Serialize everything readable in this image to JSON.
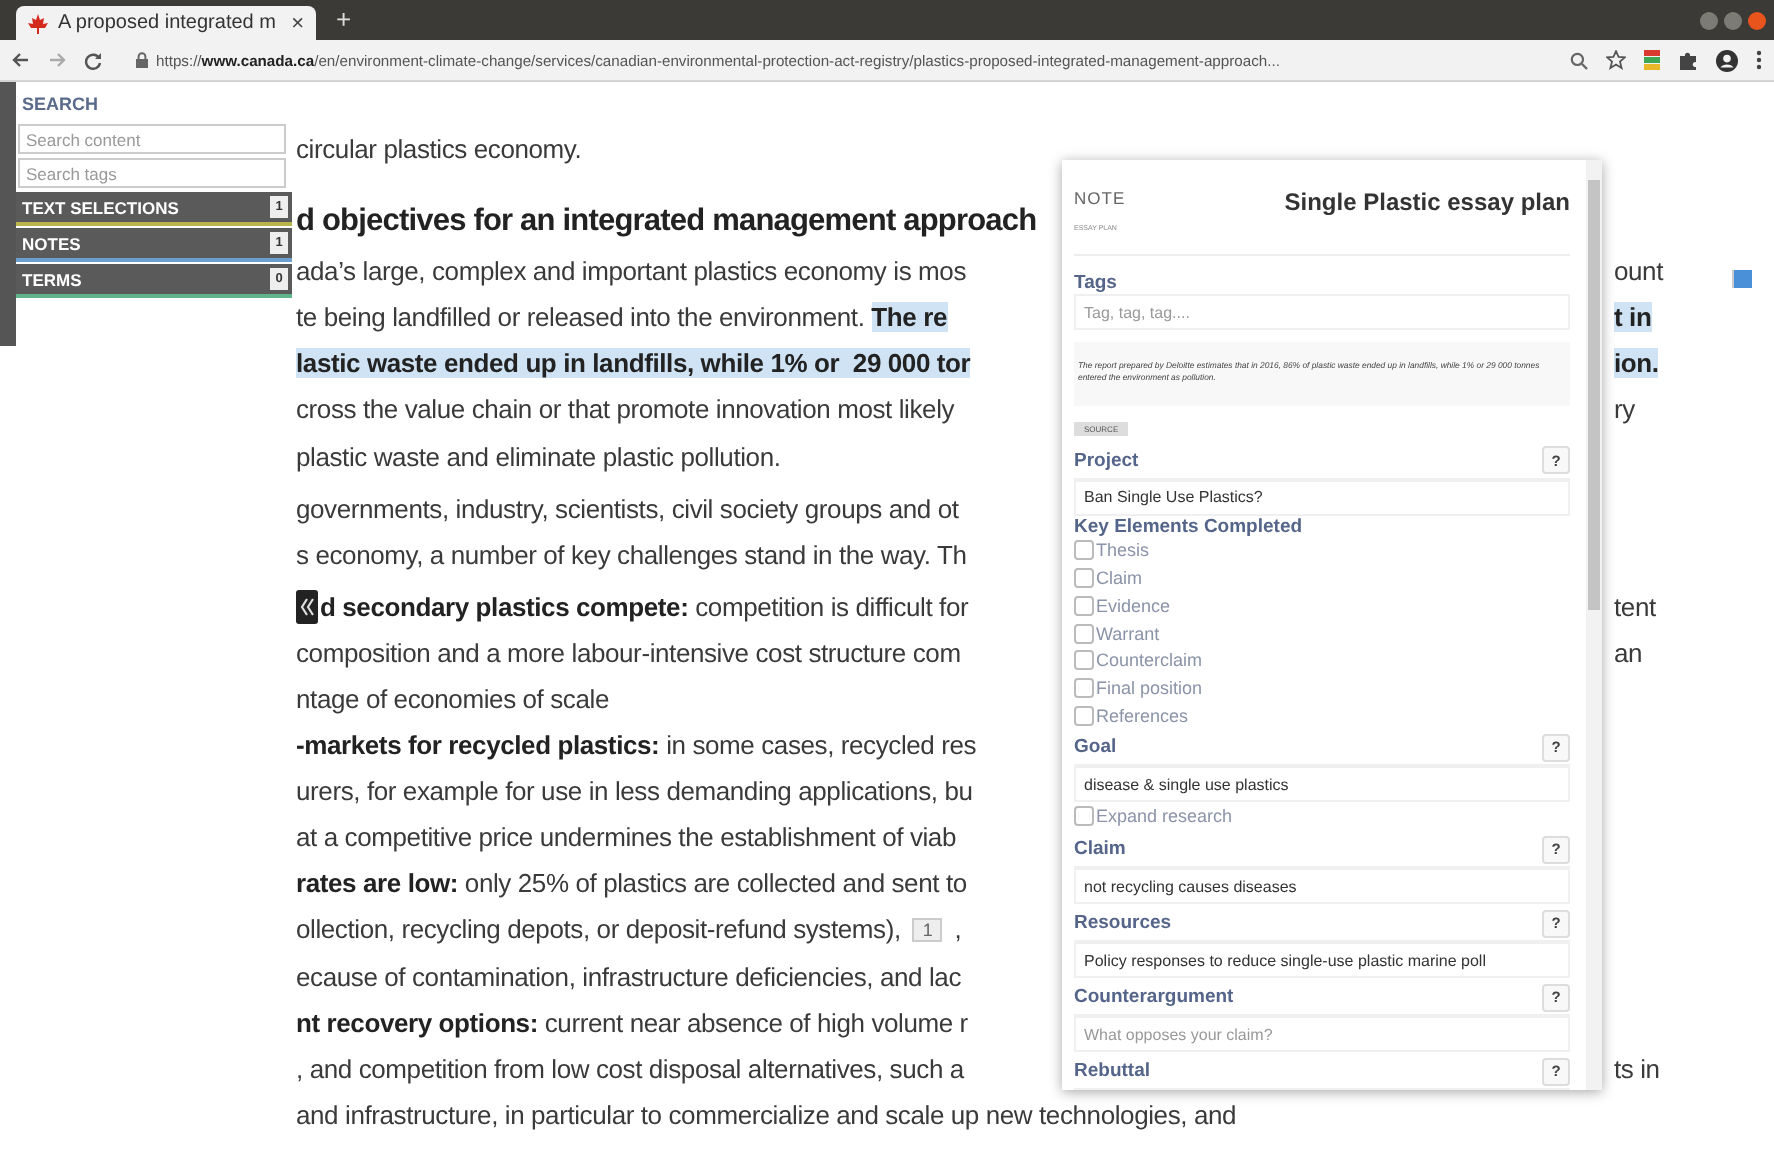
{
  "browser": {
    "tab": {
      "title": "A proposed integrated m",
      "close": "×"
    },
    "new_tab": "+",
    "url": "https://**www.canada.ca**/en/environment-climate-change/services/canadian-environmental-protection-act-registry/plastics-proposed-integrated-management-approach..."
  },
  "sidebar": {
    "title": "SEARCH",
    "fields": [
      {
        "placeholder": "Search content"
      },
      {
        "placeholder": "Search tags"
      }
    ],
    "sections": [
      {
        "label": "TEXT SELECTIONS",
        "count": "1",
        "color": "#b8b44c"
      },
      {
        "label": "NOTES",
        "count": "1",
        "color": "#6d9fd0"
      },
      {
        "label": "TERMS",
        "count": "0",
        "color": "#5fb48a"
      }
    ]
  },
  "document": {
    "lines": [
      {
        "kind": "text",
        "parts": [
          {
            "text": "circular plastics economy.",
            "bold": false,
            "highlighted": false
          }
        ]
      },
      {
        "kind": "heading",
        "parts": [
          {
            "text": "d objectives for an integrated management approach",
            "bold": true,
            "highlighted": false
          }
        ]
      },
      {
        "kind": "text",
        "parts": [
          {
            "text": "ada’s large, complex and important plastics economy is mos",
            "bold": false,
            "highlighted": false
          }
        ],
        "right": {
          "text": "ount",
          "bold": false,
          "highlighted": false
        }
      },
      {
        "kind": "text",
        "parts": [
          {
            "text": "te being landfilled or released into the environment. ",
            "bold": false,
            "highlighted": false
          },
          {
            "text": "The re",
            "bold": true,
            "highlighted": true
          }
        ],
        "right": {
          "text": "t in",
          "bold": true,
          "highlighted": true
        }
      },
      {
        "kind": "text",
        "parts": [
          {
            "text": "lastic waste ended up in landfills, while 1% or  29 000 tor",
            "bold": true,
            "highlighted": true
          }
        ],
        "right": {
          "text": "ion.",
          "bold": true,
          "highlighted": true
        }
      },
      {
        "kind": "text",
        "parts": [
          {
            "text": "cross the value chain or that promote innovation most likely",
            "bold": false,
            "highlighted": false
          }
        ],
        "right": {
          "text": "ry",
          "bold": false,
          "highlighted": false
        }
      },
      {
        "kind": "text",
        "parts": [
          {
            "text": "plastic waste and eliminate plastic pollution.",
            "bold": false,
            "highlighted": false
          }
        ]
      },
      {
        "kind": "paragraph",
        "parts": [
          {
            "text": "governments, industry, scientists, civil society groups and ot",
            "bold": false,
            "highlighted": false
          }
        ]
      },
      {
        "kind": "text",
        "parts": [
          {
            "text": "s economy, a number of key challenges stand in the way. Th",
            "bold": false,
            "highlighted": false
          }
        ]
      },
      {
        "kind": "marker",
        "parts": [
          {
            "text": "d secondary plastics compete:",
            "bold": true,
            "highlighted": false
          },
          {
            "text": " competition is difficult for",
            "bold": false,
            "highlighted": false
          }
        ],
        "right": {
          "text": "tent",
          "bold": false,
          "highlighted": false
        }
      },
      {
        "kind": "text",
        "parts": [
          {
            "text": "composition and a more labour-intensive cost structure com",
            "bold": false,
            "highlighted": false
          }
        ],
        "right": {
          "text": "an",
          "bold": false,
          "highlighted": false
        }
      },
      {
        "kind": "text",
        "parts": [
          {
            "text": "ntage of economies of scale",
            "bold": false,
            "highlighted": false
          }
        ]
      },
      {
        "kind": "text",
        "parts": [
          {
            "text": "-markets for recycled plastics:",
            "bold": true,
            "highlighted": false
          },
          {
            "text": " in some cases, recycled res",
            "bold": false,
            "highlighted": false
          }
        ]
      },
      {
        "kind": "text",
        "parts": [
          {
            "text": "urers, for example for use in less demanding applications, bu",
            "bold": false,
            "highlighted": false
          }
        ]
      },
      {
        "kind": "text",
        "parts": [
          {
            "text": "at a competitive price undermines the establishment of viab",
            "bold": false,
            "highlighted": false
          }
        ]
      },
      {
        "kind": "text",
        "parts": [
          {
            "text": "rates are low:",
            "bold": true,
            "highlighted": false
          },
          {
            "text": " only 25% of plastics are collected and sent to",
            "bold": false,
            "highlighted": false
          }
        ]
      },
      {
        "kind": "footnoted",
        "parts": [
          {
            "text": "ollection, recycling depots, or deposit-refund systems),",
            "bold": false,
            "highlighted": false
          },
          {
            "text": "1",
            "kind": "footnote"
          },
          {
            "text": ",",
            "bold": false,
            "highlighted": false
          }
        ]
      },
      {
        "kind": "text",
        "parts": [
          {
            "text": "ecause of contamination, infrastructure deficiencies, and lac",
            "bold": false,
            "highlighted": false
          }
        ]
      },
      {
        "kind": "text",
        "parts": [
          {
            "text": "nt recovery options:",
            "bold": true,
            "highlighted": false
          },
          {
            "text": " current near absence of high volume r",
            "bold": false,
            "highlighted": false
          }
        ]
      },
      {
        "kind": "text",
        "parts": [
          {
            "text": ", and competition from low cost disposal alternatives, such a",
            "bold": false,
            "highlighted": false
          }
        ],
        "right": {
          "text": "ts in",
          "bold": false,
          "highlighted": false
        }
      },
      {
        "kind": "text",
        "parts": [
          {
            "text": "and infrastructure, in particular to commercialize and scale up new technologies, and",
            "bold": false,
            "highlighted": false
          }
        ]
      }
    ]
  },
  "note": {
    "label": "NOTE",
    "sublabel": "ESSAY PLAN",
    "title": "Single Plastic essay plan",
    "tags": {
      "label": "Tags",
      "placeholder": "Tag, tag, tag...."
    },
    "quote": "The report prepared by Deloitte estimates that in 2016, 86% of plastic waste ended up in landfills, while 1% or 29 000 tonnes entered the environment as pollution.",
    "source": "SOURCE",
    "fields": [
      {
        "kind": "field",
        "label": "Project",
        "help": "?",
        "value": "Ban Single Use Plastics?"
      },
      {
        "kind": "checklist",
        "label": "Key Elements Completed",
        "items": [
          {
            "label": "Thesis",
            "checked": false
          },
          {
            "label": "Claim",
            "checked": false
          },
          {
            "label": "Evidence",
            "checked": false
          },
          {
            "label": "Warrant",
            "checked": false
          },
          {
            "label": "Counterclaim",
            "checked": false
          },
          {
            "label": "Final position",
            "checked": false
          },
          {
            "label": "References",
            "checked": false
          }
        ]
      },
      {
        "kind": "field",
        "label": "Goal",
        "help": "?",
        "value": "disease & single use plastics"
      },
      {
        "kind": "checkbox",
        "label": "Expand research",
        "checked": false
      },
      {
        "kind": "field",
        "label": "Claim",
        "help": "?",
        "value": "not recycling causes diseases"
      },
      {
        "kind": "field",
        "label": "Resources",
        "help": "?",
        "value": "Policy responses to reduce single-use plastic marine poll"
      },
      {
        "kind": "field",
        "label": "Counterargument",
        "help": "?",
        "placeholder": "What opposes your claim?"
      },
      {
        "kind": "field",
        "label": "Rebuttal",
        "help": "?"
      }
    ]
  }
}
